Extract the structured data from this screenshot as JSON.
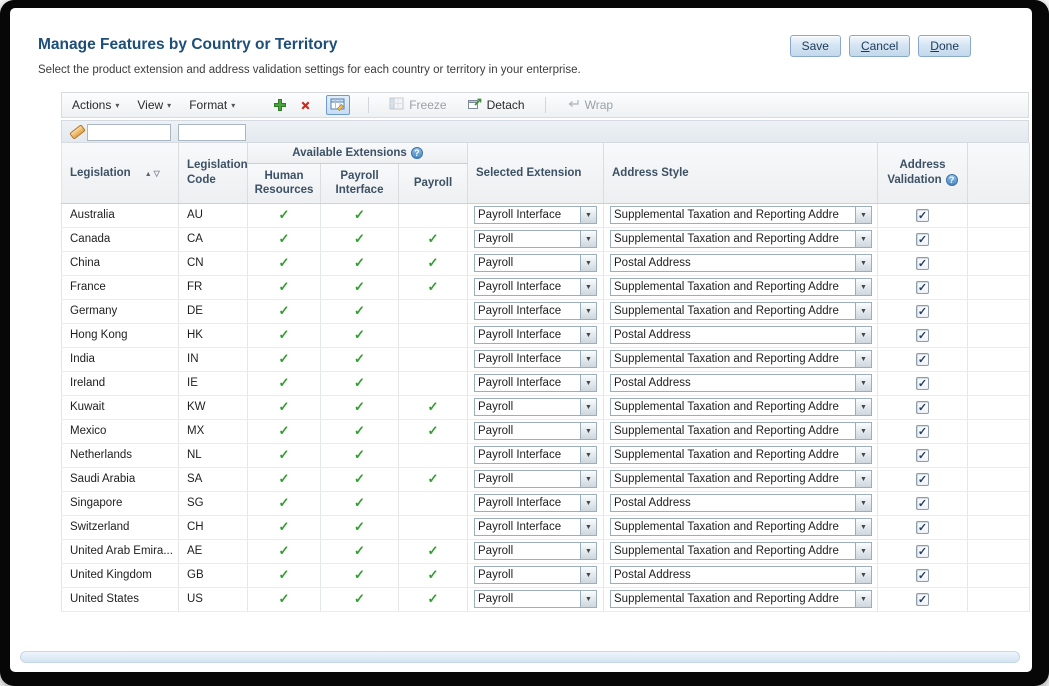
{
  "page": {
    "title": "Manage Features by Country or Territory",
    "subtitle": "Select the product extension and address validation settings for each country or territory in your enterprise.",
    "buttons": {
      "save": "Save",
      "cancel": "Cancel",
      "done": "Done"
    }
  },
  "toolbar": {
    "menus": [
      "Actions",
      "View",
      "Format"
    ],
    "freeze": "Freeze",
    "detach": "Detach",
    "wrap": "Wrap"
  },
  "filters": {
    "legislation": "",
    "legislation_code": ""
  },
  "table": {
    "headers": {
      "legislation": "Legislation",
      "legislation_code": "Legislation Code",
      "available_extensions": "Available Extensions",
      "human_resources": "Human Resources",
      "payroll_interface": "Payroll Interface",
      "payroll": "Payroll",
      "selected_extension": "Selected Extension",
      "address_style": "Address Style",
      "address_validation": "Address Validation"
    },
    "rows": [
      {
        "legislation": "Australia",
        "code": "AU",
        "hr": true,
        "pi": true,
        "payroll": false,
        "selected": "Payroll Interface",
        "address_style": "Supplemental Taxation and Reporting Addre",
        "validation": true
      },
      {
        "legislation": "Canada",
        "code": "CA",
        "hr": true,
        "pi": true,
        "payroll": true,
        "selected": "Payroll",
        "address_style": "Supplemental Taxation and Reporting Addre",
        "validation": true
      },
      {
        "legislation": "China",
        "code": "CN",
        "hr": true,
        "pi": true,
        "payroll": true,
        "selected": "Payroll",
        "address_style": "Postal Address",
        "validation": true
      },
      {
        "legislation": "France",
        "code": "FR",
        "hr": true,
        "pi": true,
        "payroll": true,
        "selected": "Payroll Interface",
        "address_style": "Supplemental Taxation and Reporting Addre",
        "validation": true
      },
      {
        "legislation": "Germany",
        "code": "DE",
        "hr": true,
        "pi": true,
        "payroll": false,
        "selected": "Payroll Interface",
        "address_style": "Supplemental Taxation and Reporting Addre",
        "validation": true
      },
      {
        "legislation": "Hong Kong",
        "code": "HK",
        "hr": true,
        "pi": true,
        "payroll": false,
        "selected": "Payroll Interface",
        "address_style": "Postal Address",
        "validation": true
      },
      {
        "legislation": "India",
        "code": "IN",
        "hr": true,
        "pi": true,
        "payroll": false,
        "selected": "Payroll Interface",
        "address_style": "Supplemental Taxation and Reporting Addre",
        "validation": true
      },
      {
        "legislation": "Ireland",
        "code": "IE",
        "hr": true,
        "pi": true,
        "payroll": false,
        "selected": "Payroll Interface",
        "address_style": "Postal Address",
        "validation": true
      },
      {
        "legislation": "Kuwait",
        "code": "KW",
        "hr": true,
        "pi": true,
        "payroll": true,
        "selected": "Payroll",
        "address_style": "Supplemental Taxation and Reporting Addre",
        "validation": true
      },
      {
        "legislation": "Mexico",
        "code": "MX",
        "hr": true,
        "pi": true,
        "payroll": true,
        "selected": "Payroll",
        "address_style": "Supplemental Taxation and Reporting Addre",
        "validation": true
      },
      {
        "legislation": "Netherlands",
        "code": "NL",
        "hr": true,
        "pi": true,
        "payroll": false,
        "selected": "Payroll Interface",
        "address_style": "Supplemental Taxation and Reporting Addre",
        "validation": true
      },
      {
        "legislation": "Saudi Arabia",
        "code": "SA",
        "hr": true,
        "pi": true,
        "payroll": true,
        "selected": "Payroll",
        "address_style": "Supplemental Taxation and Reporting Addre",
        "validation": true
      },
      {
        "legislation": "Singapore",
        "code": "SG",
        "hr": true,
        "pi": true,
        "payroll": false,
        "selected": "Payroll Interface",
        "address_style": "Postal Address",
        "validation": true
      },
      {
        "legislation": "Switzerland",
        "code": "CH",
        "hr": true,
        "pi": true,
        "payroll": false,
        "selected": "Payroll Interface",
        "address_style": "Supplemental Taxation and Reporting Addre",
        "validation": true
      },
      {
        "legislation": "United Arab Emira...",
        "code": "AE",
        "hr": true,
        "pi": true,
        "payroll": true,
        "selected": "Payroll",
        "address_style": "Supplemental Taxation and Reporting Addre",
        "validation": true
      },
      {
        "legislation": "United Kingdom",
        "code": "GB",
        "hr": true,
        "pi": true,
        "payroll": true,
        "selected": "Payroll",
        "address_style": "Postal Address",
        "validation": true
      },
      {
        "legislation": "United States",
        "code": "US",
        "hr": true,
        "pi": true,
        "payroll": true,
        "selected": "Payroll",
        "address_style": "Supplemental Taxation and Reporting Addre",
        "validation": true
      }
    ]
  }
}
